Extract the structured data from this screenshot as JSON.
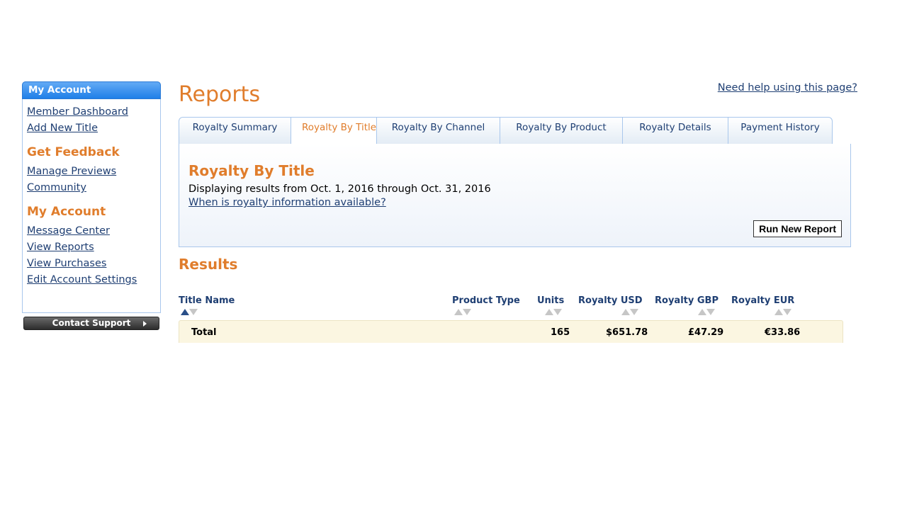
{
  "sidebar": {
    "header": "My Account",
    "top_links": [
      "Member Dashboard",
      "Add New Title"
    ],
    "feedback_heading": "Get Feedback",
    "feedback_links": [
      "Manage Previews",
      "Community"
    ],
    "account_heading": "My Account",
    "account_links": [
      "Message Center",
      "View Reports",
      "View Purchases",
      "Edit Account Settings"
    ],
    "support_button": "Contact Support"
  },
  "page": {
    "title": "Reports",
    "help_link": "Need help using this page?"
  },
  "tabs": [
    {
      "label": "Royalty Summary",
      "active": false
    },
    {
      "label": "Royalty By Title",
      "active": true
    },
    {
      "label": "Royalty By Channel",
      "active": false
    },
    {
      "label": "Royalty By Product",
      "active": false
    },
    {
      "label": "Royalty Details",
      "active": false
    },
    {
      "label": "Payment History",
      "active": false
    }
  ],
  "panel": {
    "title": "Royalty By Title",
    "description": "Displaying results from Oct. 1, 2016 through Oct. 31, 2016",
    "info_link": "When is royalty information available?",
    "run_button": "Run New Report"
  },
  "results": {
    "title": "Results",
    "columns": [
      "Title Name",
      "Product Type",
      "Units",
      "Royalty USD",
      "Royalty GBP",
      "Royalty EUR"
    ],
    "total": {
      "label": "Total",
      "units": "165",
      "usd": "$651.78",
      "gbp": "£47.29",
      "eur": "€33.86"
    }
  },
  "colors": {
    "accent_orange": "#e07d2c",
    "link_blue": "#1f3f73",
    "border_blue": "#a9c7ec",
    "total_row_bg": "#fbf6e1"
  }
}
